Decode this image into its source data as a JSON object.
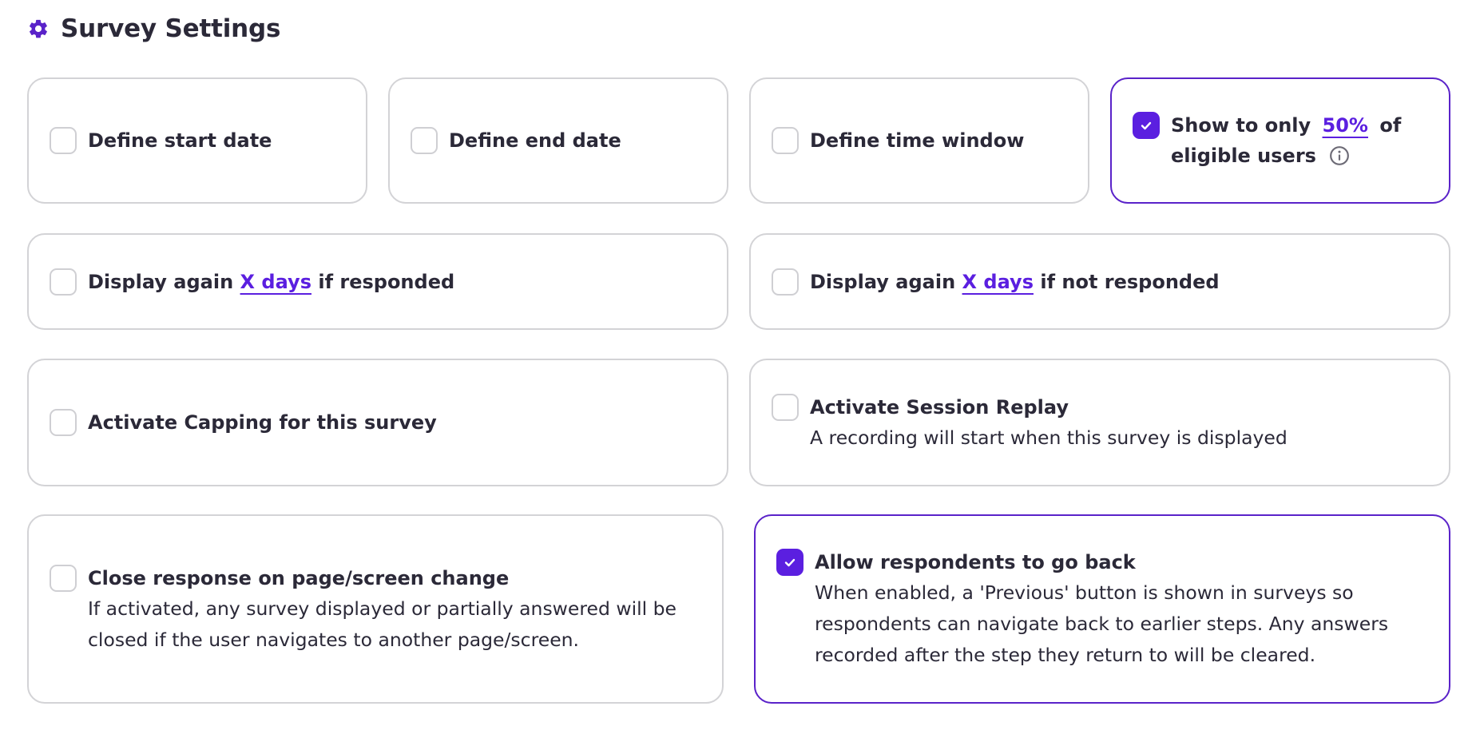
{
  "header": {
    "title": "Survey Settings",
    "icon": "gear-icon"
  },
  "colors": {
    "accent": "#5b1fe0",
    "border": "#d3d3d6",
    "text": "#2b2938"
  },
  "settings": {
    "start_date": {
      "label": "Define start date",
      "checked": false
    },
    "end_date": {
      "label": "Define end date",
      "checked": false
    },
    "time_window": {
      "label": "Define time window",
      "checked": false
    },
    "show_to_only": {
      "prefix": "Show to only",
      "percent": "50%",
      "suffix": "of",
      "line2": "eligible users",
      "checked": true
    },
    "display_again_responded": {
      "prefix": "Display again",
      "link": "X days",
      "suffix": "if responded",
      "checked": false
    },
    "display_again_not_responded": {
      "prefix": "Display again",
      "link": "X days",
      "suffix": "if not responded",
      "checked": false
    },
    "capping": {
      "label": "Activate Capping for this survey",
      "checked": false
    },
    "session_replay": {
      "label": "Activate Session Replay",
      "description": "A recording will start when this survey is displayed",
      "checked": false
    },
    "close_response": {
      "label": "Close response on page/screen change",
      "description_line1": "If activated, any survey displayed or partially answered will be",
      "description_line2": "closed if the user navigates to another page/screen.",
      "checked": false
    },
    "go_back": {
      "label": "Allow respondents to go back",
      "description_line1": "When enabled, a 'Previous' button is shown in surveys so",
      "description_line2": "respondents can navigate back to earlier steps. Any answers",
      "description_line3": "recorded after the step they return to will be cleared.",
      "checked": true
    }
  }
}
